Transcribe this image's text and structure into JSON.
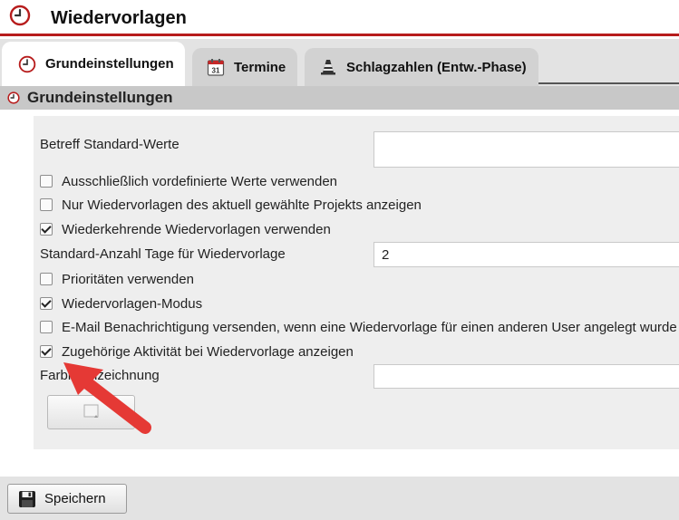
{
  "header": {
    "title": "Wiedervorlagen",
    "icon": "clock-icon"
  },
  "tabs": [
    {
      "label": "Grundeinstellungen",
      "icon": "clock-icon",
      "active": true
    },
    {
      "label": "Termine",
      "icon": "calendar-icon",
      "icon_text": "31",
      "active": false
    },
    {
      "label": "Schlagzahlen (Entw.-Phase)",
      "icon": "traffic-cone-icon",
      "active": false
    }
  ],
  "section": {
    "title": "Grundeinstellungen",
    "icon": "clock-icon"
  },
  "form": {
    "betreff_label": "Betreff Standard-Werte",
    "betreff_value": "",
    "checkboxes": [
      {
        "label": "Ausschließlich vordefinierte Werte verwenden",
        "checked": false
      },
      {
        "label": "Nur Wiedervorlagen des aktuell gewählte Projekts anzeigen",
        "checked": false
      },
      {
        "label": "Wiederkehrende Wiedervorlagen verwenden",
        "checked": true
      },
      {
        "label": "Prioritäten verwenden",
        "checked": false
      },
      {
        "label": "Wiedervorlagen-Modus",
        "checked": true
      },
      {
        "label": "E-Mail Benachrichtigung versenden, wenn eine Wiedervorlage für einen anderen User angelegt wurde",
        "checked": false
      },
      {
        "label": "Zugehörige Aktivität bei Wiedervorlage anzeigen",
        "checked": true
      }
    ],
    "tage_label": "Standard-Anzahl Tage für Wiedervorlage",
    "tage_value": "2",
    "farb_label": "Farbkennzeichnung",
    "farb_value": "",
    "color_button_icon": "color-picker-icon"
  },
  "footer": {
    "save_label": "Speichern",
    "save_icon": "floppy-disk-icon"
  },
  "colors": {
    "accent_red": "#b71c1c",
    "annotation_arrow": "#e53935",
    "tab_bg": "#d2d2d2",
    "section_bg": "#c8c8c8",
    "panel_bg": "#eeeeee"
  }
}
